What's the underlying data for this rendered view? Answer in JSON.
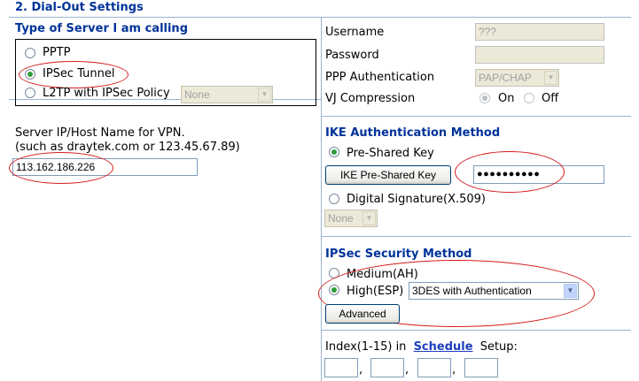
{
  "header": {
    "title": "2. Dial-Out Settings"
  },
  "server_type": {
    "heading": "Type of Server I am calling",
    "options": [
      "PPTP",
      "IPSec Tunnel",
      "L2TP with IPSec Policy"
    ],
    "selected": "IPSec Tunnel",
    "l2tp_policy": "None"
  },
  "server_host": {
    "label": "Server IP/Host Name for VPN.",
    "hint": "(such as draytek.com or 123.45.67.89)",
    "value": "113.162.186.226"
  },
  "ppp": {
    "username_label": "Username",
    "username_value": "???",
    "password_label": "Password",
    "password_value": "",
    "auth_label": "PPP Authentication",
    "auth_value": "PAP/CHAP",
    "vj_label": "VJ Compression",
    "vj_on": "On",
    "vj_off": "Off"
  },
  "ike": {
    "heading": "IKE Authentication Method",
    "psk_label": "Pre-Shared Key",
    "psk_button": "IKE Pre-Shared Key",
    "psk_value": "●●●●●●●●●●",
    "digsig_label": "Digital Signature(X.509)",
    "digsig_select": "None"
  },
  "ipsec": {
    "heading": "IPSec Security Method",
    "medium_label": "Medium(AH)",
    "high_label": "High(ESP)",
    "high_select": "3DES with Authentication",
    "advanced_button": "Advanced"
  },
  "schedule": {
    "prefix": "Index(1-15) in",
    "link": "Schedule",
    "suffix": "Setup:",
    "sep": ","
  },
  "colors": {
    "heading": "#003399",
    "annotation": "#d51c1c",
    "radio_on": "#2e9d3a"
  }
}
